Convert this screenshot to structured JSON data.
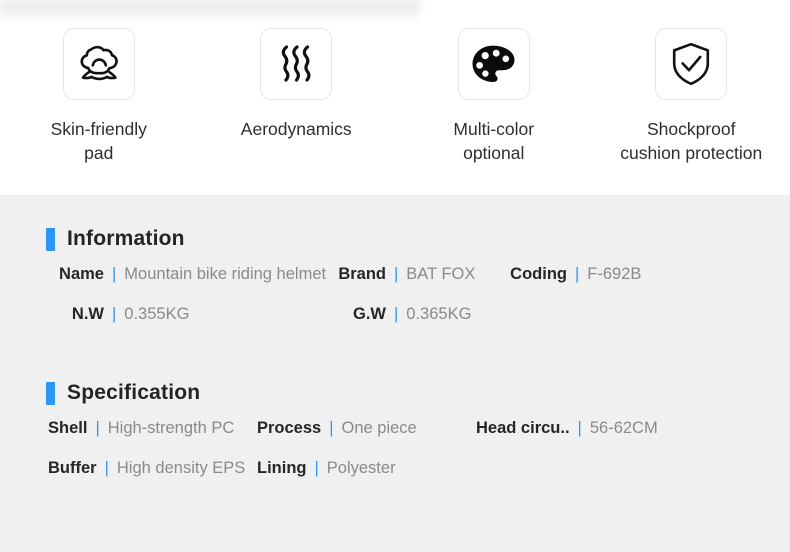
{
  "features": [
    {
      "icon": "cushion-pad-icon",
      "label": "Skin-friendly\npad"
    },
    {
      "icon": "airflow-waves-icon",
      "label": "Aerodynamics"
    },
    {
      "icon": "paint-palette-icon",
      "label": "Multi-color\noptional"
    },
    {
      "icon": "shield-check-icon",
      "label": "Shockproof\ncushion protection"
    }
  ],
  "information": {
    "title": "Information",
    "separator": "|",
    "rows": [
      [
        {
          "label": "Name",
          "value": "Mountain bike riding helmet"
        },
        {
          "label": "Brand",
          "value": "BAT FOX"
        },
        {
          "label": "Coding",
          "value": "F-692B"
        }
      ],
      [
        {
          "label": "N.W",
          "value": "0.355KG"
        },
        {
          "label": "G.W",
          "value": "0.365KG"
        }
      ]
    ]
  },
  "specification": {
    "title": "Specification",
    "separator": "|",
    "rows": [
      [
        {
          "label": "Shell",
          "value": "High-strength PC"
        },
        {
          "label": "Process",
          "value": "One piece"
        },
        {
          "label": "Head circu..",
          "value": "56-62CM"
        }
      ],
      [
        {
          "label": "Buffer",
          "value": "High density EPS"
        },
        {
          "label": "Lining",
          "value": "Polyester"
        }
      ]
    ]
  },
  "colors": {
    "accent": "#2f95f5",
    "label_text": "#262626",
    "value_text": "#8a8a8a",
    "section_bg": "#f0f0f0",
    "features_bg": "#ffffff",
    "icon_border": "#e6e6e6"
  }
}
